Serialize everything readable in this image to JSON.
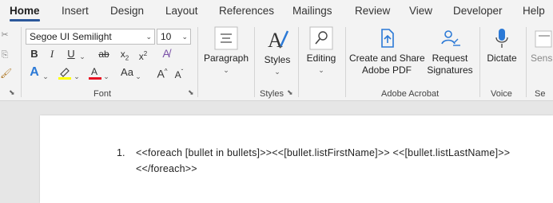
{
  "tabs": [
    "Home",
    "Insert",
    "Design",
    "Layout",
    "References",
    "Mailings",
    "Review",
    "View",
    "Developer",
    "Help"
  ],
  "font": {
    "name": "Segoe UI Semilight",
    "size": "10",
    "group_label": "Font"
  },
  "paragraph": {
    "label": "Paragraph"
  },
  "styles": {
    "label": "Styles",
    "group_label": "Styles"
  },
  "editing": {
    "label": "Editing"
  },
  "acrobat": {
    "create_label_1": "Create and Share",
    "create_label_2": "Adobe PDF",
    "request_label_1": "Request",
    "request_label_2": "Signatures",
    "group_label": "Adobe Acrobat"
  },
  "voice": {
    "dictate_label": "Dictate",
    "group_label": "Voice"
  },
  "sensitivity": {
    "label": "Sens",
    "group_label": "Se"
  },
  "document": {
    "list_number": "1.",
    "line1": "<<foreach [bullet in bullets]>><<[bullet.listFirstName]>> <<[bullet.listLastName]>>",
    "line2": "<</foreach>>"
  },
  "colors": {
    "accent": "#2b579a",
    "highlight": "#ffff00",
    "font_color": "#e81123",
    "text_effects": "#2b79d6"
  }
}
